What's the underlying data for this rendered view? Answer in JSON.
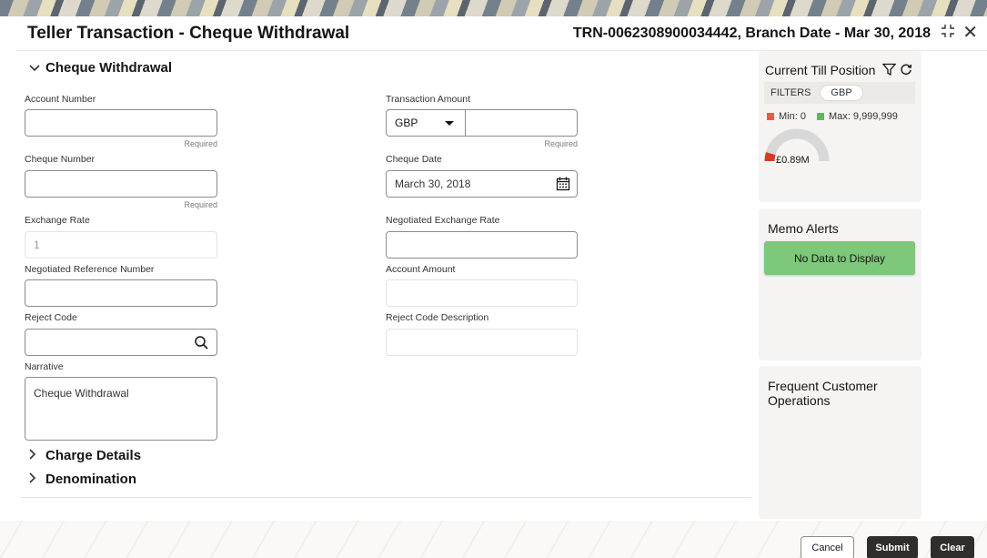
{
  "header": {
    "title": "Teller Transaction - Cheque Withdrawal",
    "transaction_info": "TRN-0062308900034442, Branch Date - Mar 30, 2018"
  },
  "sections": {
    "cheque_withdrawal": "Cheque Withdrawal",
    "charge_details": "Charge Details",
    "denomination": "Denomination"
  },
  "fields": {
    "account_number": {
      "label": "Account Number",
      "value": "",
      "hint": "Required"
    },
    "transaction_amount": {
      "label": "Transaction Amount",
      "currency": "GBP",
      "value": "",
      "hint": "Required"
    },
    "cheque_number": {
      "label": "Cheque Number",
      "value": "",
      "hint": "Required"
    },
    "cheque_date": {
      "label": "Cheque Date",
      "value": "March 30, 2018"
    },
    "exchange_rate": {
      "label": "Exchange Rate",
      "value": "1"
    },
    "negotiated_exchange_rate": {
      "label": "Negotiated Exchange Rate",
      "value": ""
    },
    "negotiated_reference_number": {
      "label": "Negotiated Reference Number",
      "value": ""
    },
    "account_amount": {
      "label": "Account Amount",
      "value": ""
    },
    "reject_code": {
      "label": "Reject Code",
      "value": ""
    },
    "reject_code_description": {
      "label": "Reject Code Description",
      "value": ""
    },
    "narrative": {
      "label": "Narrative",
      "value": "Cheque Withdrawal"
    }
  },
  "till_position": {
    "title": "Current Till Position",
    "filters_label": "FILTERS",
    "currency_chip": "GBP",
    "min_label": "Min: 0",
    "max_label": "Max: 9,999,999",
    "gauge_value": "£0.89M",
    "gauge_fraction": 0.09,
    "min_color": "#e8594a",
    "max_color": "#5cb85c"
  },
  "memo_alerts": {
    "title": "Memo Alerts",
    "empty_text": "No Data to Display"
  },
  "frequent_ops": {
    "title_line1": "Frequent Customer",
    "title_line2": "Operations"
  },
  "footer": {
    "cancel": "Cancel",
    "submit": "Submit",
    "clear": "Clear"
  },
  "colors": {
    "primary_button": "#312d2a",
    "gauge_fill": "#d63b25",
    "no_data_bg": "#7dc87a"
  }
}
